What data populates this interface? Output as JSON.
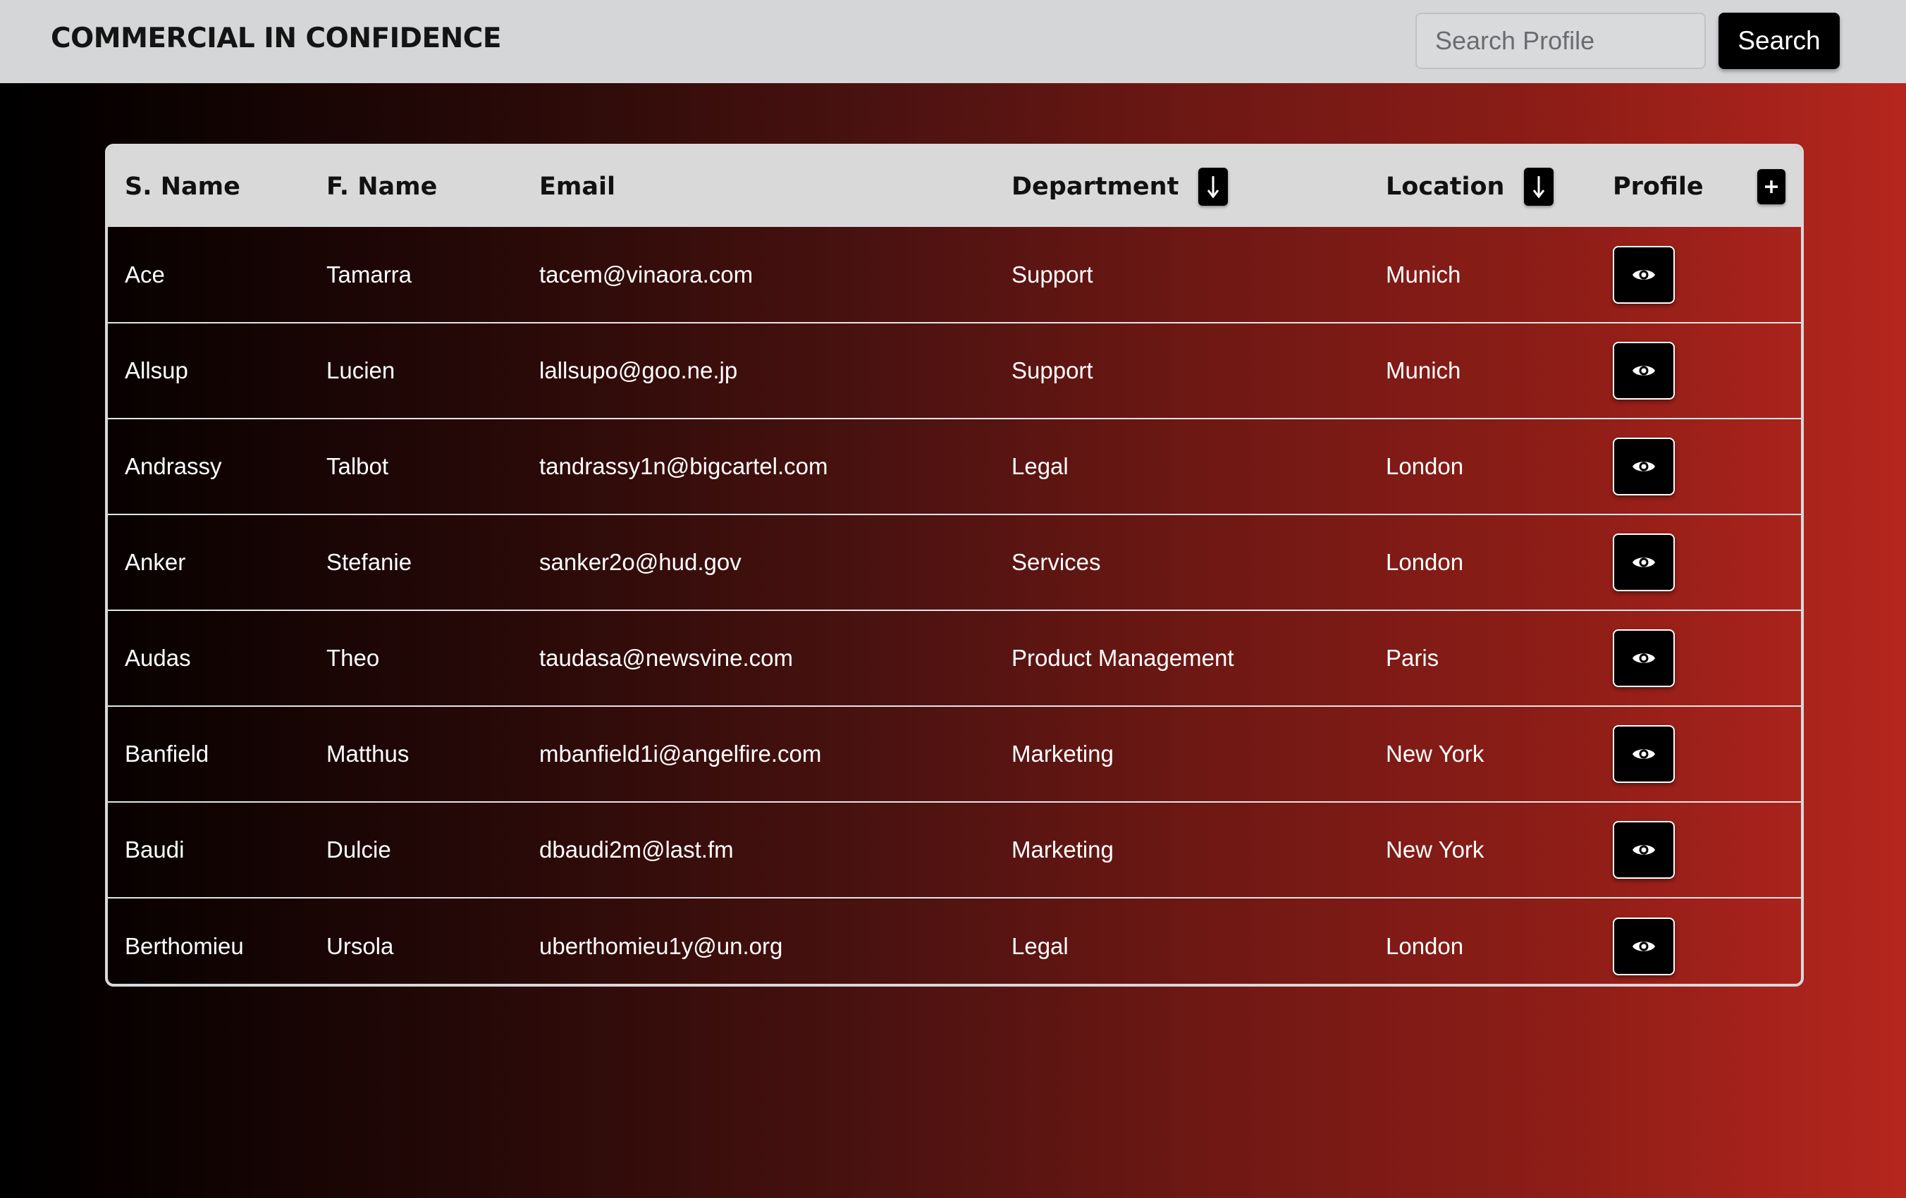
{
  "header": {
    "brand": "COMMERCIAL IN CONFIDENCE",
    "search_placeholder": "Search Profile",
    "search_value": "",
    "search_button": "Search"
  },
  "table": {
    "columns": {
      "surname": "S. Name",
      "first_name": "F. Name",
      "email": "Email",
      "department": "Department",
      "location": "Location",
      "profile": "Profile"
    },
    "icons": {
      "department_sort": "arrow-down-icon",
      "location_sort": "arrow-down-icon",
      "add_profile": "plus-icon",
      "view_profile": "eye-icon"
    },
    "rows": [
      {
        "surname": "Ace",
        "first_name": "Tamarra",
        "email": "tacem@vinaora.com",
        "department": "Support",
        "location": "Munich"
      },
      {
        "surname": "Allsup",
        "first_name": "Lucien",
        "email": "lallsupo@goo.ne.jp",
        "department": "Support",
        "location": "Munich"
      },
      {
        "surname": "Andrassy",
        "first_name": "Talbot",
        "email": "tandrassy1n@bigcartel.com",
        "department": "Legal",
        "location": "London"
      },
      {
        "surname": "Anker",
        "first_name": "Stefanie",
        "email": "sanker2o@hud.gov",
        "department": "Services",
        "location": "London"
      },
      {
        "surname": "Audas",
        "first_name": "Theo",
        "email": "taudasa@newsvine.com",
        "department": "Product Management",
        "location": "Paris"
      },
      {
        "surname": "Banfield",
        "first_name": "Matthus",
        "email": "mbanfield1i@angelfire.com",
        "department": "Marketing",
        "location": "New York"
      },
      {
        "surname": "Baudi",
        "first_name": "Dulcie",
        "email": "dbaudi2m@last.fm",
        "department": "Marketing",
        "location": "New York"
      },
      {
        "surname": "Berthomieu",
        "first_name": "Ursola",
        "email": "uberthomieu1y@un.org",
        "department": "Legal",
        "location": "London"
      }
    ]
  },
  "colors": {
    "header_bg": "#d5d6d8",
    "table_header_bg": "#d9d9da",
    "button_bg": "#000000",
    "gradient_start": "#000000",
    "gradient_end": "#b5261e"
  }
}
